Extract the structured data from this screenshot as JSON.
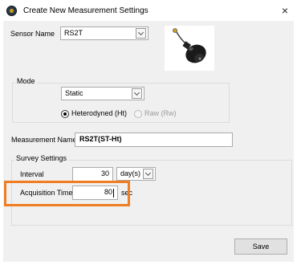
{
  "window": {
    "title": "Create New Measurement Settings",
    "close_glyph": "×",
    "icon": "app-sensor-icon"
  },
  "sensor": {
    "label": "Sensor Name",
    "value": "RS2T",
    "image": "sensor-probe-image"
  },
  "mode": {
    "group_label": "Mode",
    "value": "Static",
    "radio_ht": {
      "label": "Heterodyned (Ht)",
      "checked": true
    },
    "radio_rw": {
      "label": "Raw (Rw)",
      "checked": false,
      "disabled": true
    }
  },
  "measurement": {
    "label": "Measurement Name",
    "value": "RS2T(ST-Ht)"
  },
  "survey": {
    "group_label": "Survey Settings",
    "interval_label": "Interval",
    "interval_value": "30",
    "interval_unit": "day(s)",
    "acq_label": "Acquisition Time",
    "acq_value": "80",
    "acq_unit": "sec"
  },
  "footer": {
    "save_label": "Save"
  },
  "colors": {
    "highlight": "#ef7d22",
    "window_bg": "#f0f0f0"
  }
}
